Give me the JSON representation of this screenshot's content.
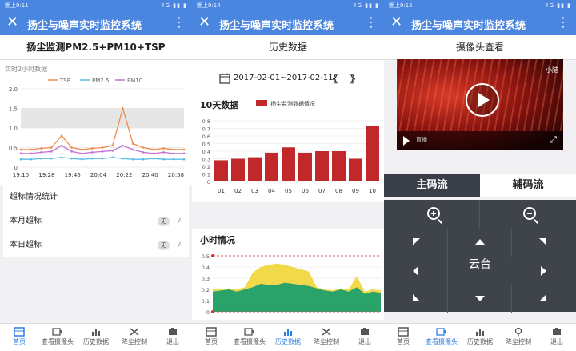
{
  "status": {
    "time1": "晚上9:11",
    "time2": "晚上9:14",
    "time3": "晚上9:15",
    "right": "4G ▮▮ ▮"
  },
  "app": {
    "title": "扬尘与噪声实时监控系统"
  },
  "screen1": {
    "page_title": "扬尘监测PM2.5+PM10+TSP",
    "chart_label": "实时2小时数据",
    "stats_title": "超标情况统计",
    "rows": [
      {
        "label": "本月超标",
        "badge": "无"
      },
      {
        "label": "本日超标",
        "badge": "无"
      }
    ]
  },
  "screen2": {
    "page_title": "历史数据",
    "date_range": "2017-02-01~2017-02-11",
    "nav": "《 》",
    "day_title": "10天数据",
    "day_legend": "扬尘监测数据情况",
    "hour_title": "小时情况"
  },
  "screen3": {
    "page_title": "摄像头查看",
    "video_logo": "小脑",
    "video_caption": "直播",
    "stream_main": "主码流",
    "stream_sub": "辅码流",
    "ptz_label": "云台"
  },
  "tabs1": [
    "首页",
    "查看摄像头",
    "历史数据",
    "降尘控制",
    "退出"
  ],
  "tabs2": [
    "首页",
    "查看摄像头",
    "历史数据",
    "降尘控制",
    "退出"
  ],
  "tabs3": [
    "首页",
    "查看摄像头",
    "历史数据",
    "降尘控制",
    "退出"
  ],
  "colors": {
    "primary": "#4a86e0",
    "active": "#2d7be5",
    "tsp": "#f08a4b",
    "pm25": "#5bbde4",
    "pm10": "#c46fd1",
    "bar": "#c0282c",
    "yellow": "#f2d94a",
    "green": "#2aa36b"
  },
  "chart_data": [
    {
      "type": "line",
      "x": [
        "19:10",
        "19:28",
        "19:46",
        "20:04",
        "20:22",
        "20:40",
        "20:58"
      ],
      "ylim": [
        0,
        2.0
      ],
      "yticks": [
        "0",
        "0.5",
        "1.0",
        "1.5",
        "2.0"
      ],
      "series": [
        {
          "name": "TSP",
          "values": [
            0.45,
            0.45,
            0.48,
            0.5,
            0.8,
            0.5,
            0.45,
            0.48,
            0.5,
            0.55,
            1.5,
            0.6,
            0.5,
            0.45,
            0.48,
            0.45,
            0.45
          ]
        },
        {
          "name": "PM2.5",
          "values": [
            0.2,
            0.2,
            0.22,
            0.22,
            0.25,
            0.22,
            0.2,
            0.22,
            0.22,
            0.25,
            0.22,
            0.2,
            0.2,
            0.22,
            0.2,
            0.2,
            0.2
          ]
        },
        {
          "name": "PM10",
          "values": [
            0.35,
            0.35,
            0.38,
            0.4,
            0.55,
            0.4,
            0.35,
            0.38,
            0.4,
            0.42,
            0.55,
            0.45,
            0.38,
            0.35,
            0.38,
            0.35,
            0.35
          ]
        }
      ]
    },
    {
      "type": "bar",
      "categories": [
        "01",
        "02",
        "03",
        "04",
        "05",
        "06",
        "07",
        "08",
        "09",
        "10"
      ],
      "yticks": [
        "0",
        "0.1",
        "0.2",
        "0.3",
        "0.4",
        "0.5",
        "0.6",
        "0.7",
        "0.8"
      ],
      "ylim": [
        0,
        0.8
      ],
      "series": [
        {
          "name": "扬尘监测数据情况",
          "values": [
            0.28,
            0.3,
            0.32,
            0.38,
            0.45,
            0.38,
            0.4,
            0.4,
            0.3,
            0.73
          ]
        }
      ]
    },
    {
      "type": "area",
      "yticks": [
        "0",
        "0.1",
        "0.2",
        "0.3",
        "0.4",
        "0.5"
      ],
      "ylim": [
        0,
        0.5
      ],
      "series": [
        {
          "name": "yellow",
          "values": [
            0.2,
            0.2,
            0.21,
            0.2,
            0.22,
            0.35,
            0.4,
            0.42,
            0.43,
            0.42,
            0.4,
            0.38,
            0.36,
            0.22,
            0.2,
            0.19,
            0.21,
            0.2,
            0.32,
            0.18,
            0.2,
            0.19
          ]
        },
        {
          "name": "green",
          "values": [
            0.18,
            0.19,
            0.2,
            0.18,
            0.2,
            0.22,
            0.25,
            0.24,
            0.24,
            0.26,
            0.25,
            0.24,
            0.23,
            0.21,
            0.19,
            0.18,
            0.2,
            0.18,
            0.22,
            0.16,
            0.18,
            0.17
          ]
        }
      ]
    }
  ]
}
